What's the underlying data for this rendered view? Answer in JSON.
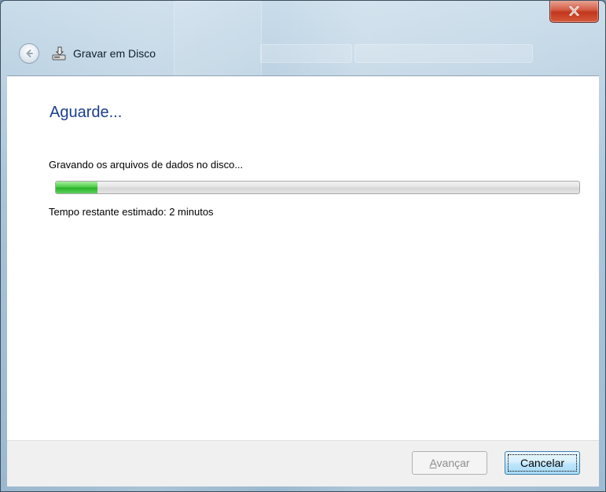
{
  "window": {
    "title": "Gravar em Disco",
    "close_icon": "close-x-icon",
    "back_icon": "back-arrow-icon",
    "title_icon": "burn-disc-icon"
  },
  "main": {
    "heading": "Aguarde...",
    "status": "Gravando os arquivos de dados no disco...",
    "progress_fraction": 0.08,
    "time_remaining": "Tempo restante estimado: 2 minutos"
  },
  "buttons": {
    "next_label": "Avançar",
    "next_accel": "A",
    "next_rest": "vançar",
    "cancel_label": "Cancelar"
  },
  "colors": {
    "heading": "#1a3e8f",
    "progress_fill": "#2bb32a",
    "close_button": "#c1371d"
  }
}
